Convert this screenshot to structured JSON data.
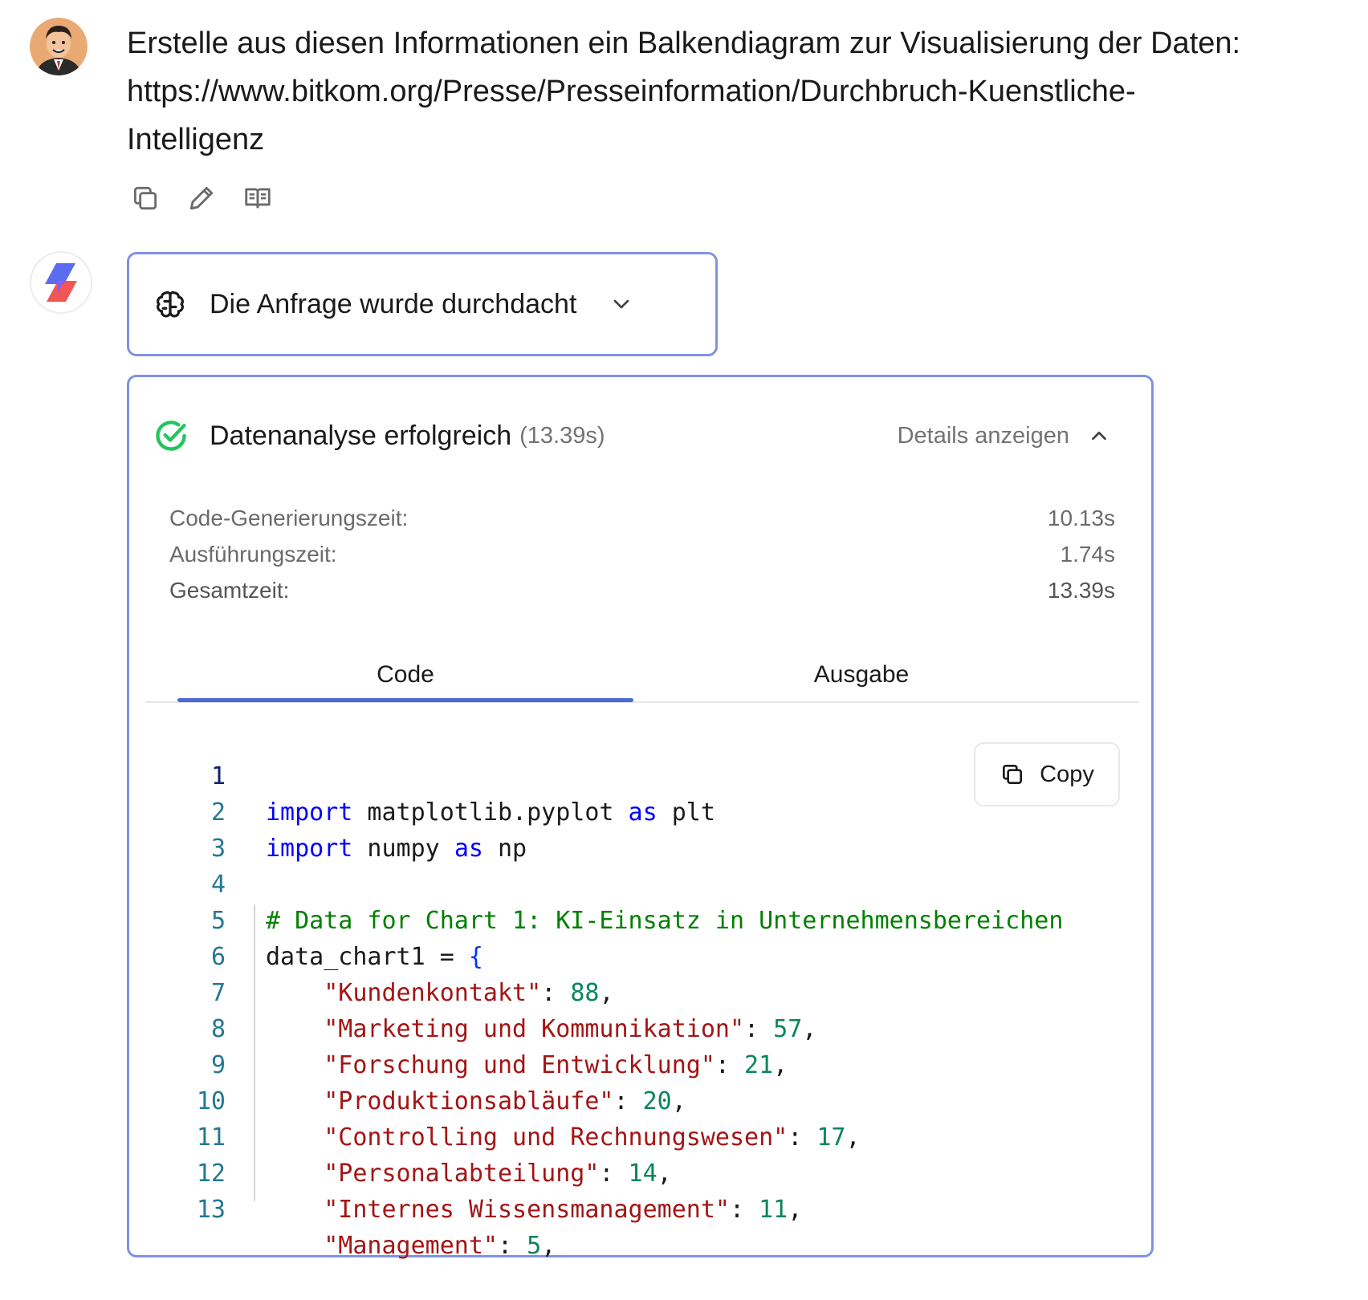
{
  "user_message": {
    "lines": [
      "Erstelle aus diesen Informationen ein Balkendiagram zur Visualisierung der Daten:",
      "https://www.bitkom.org/Presse/Presseinformation/Durchbruch-Kuenstliche-",
      "Intelligenz"
    ],
    "actions": [
      "copy-icon",
      "edit-icon",
      "read-aloud-icon"
    ]
  },
  "thought": {
    "label": "Die Anfrage wurde durchdacht",
    "icon": "brain-icon"
  },
  "analysis": {
    "title": "Datenanalyse erfolgreich",
    "time": "(13.39s)",
    "details_label": "Details anzeigen",
    "stats": [
      {
        "label": "Code-Generierungszeit:",
        "value": "10.13s"
      },
      {
        "label": "Ausführungszeit:",
        "value": "1.74s"
      },
      {
        "label": "Gesamtzeit:",
        "value": "13.39s"
      }
    ],
    "tabs": [
      "Code",
      "Ausgabe"
    ],
    "active_tab": "Code",
    "copy_label": "Copy"
  },
  "code": {
    "line_numbers": [
      "1",
      "2",
      "3",
      "4",
      "5",
      "6",
      "7",
      "8",
      "9",
      "10",
      "11",
      "12",
      "13"
    ],
    "l1": {
      "kw1": "import",
      "mid": " matplotlib.pyplot ",
      "kw2": "as",
      "end": " plt"
    },
    "l2": {
      "kw1": "import",
      "mid": " numpy ",
      "kw2": "as",
      "end": " np"
    },
    "l4": {
      "comment": "# Data for Chart 1: KI-Einsatz in Unternehmensbereichen"
    },
    "l5": {
      "text": "data_chart1 = ",
      "brace": "{"
    },
    "entries": [
      {
        "key": "\"Kundenkontakt\"",
        "value": "88"
      },
      {
        "key": "\"Marketing und Kommunikation\"",
        "value": "57"
      },
      {
        "key": "\"Forschung und Entwicklung\"",
        "value": "21"
      },
      {
        "key": "\"Produktionsabläufe\"",
        "value": "20"
      },
      {
        "key": "\"Controlling und Rechnungswesen\"",
        "value": "17"
      },
      {
        "key": "\"Personalabteilung\"",
        "value": "14"
      },
      {
        "key": "\"Internes Wissensmanagement\"",
        "value": "11"
      },
      {
        "key": "\"Management\"",
        "value": "5"
      }
    ]
  },
  "colors": {
    "accent_border": "#7f93e3",
    "tab_underline": "#4a6bd6",
    "success": "#22c55e"
  }
}
